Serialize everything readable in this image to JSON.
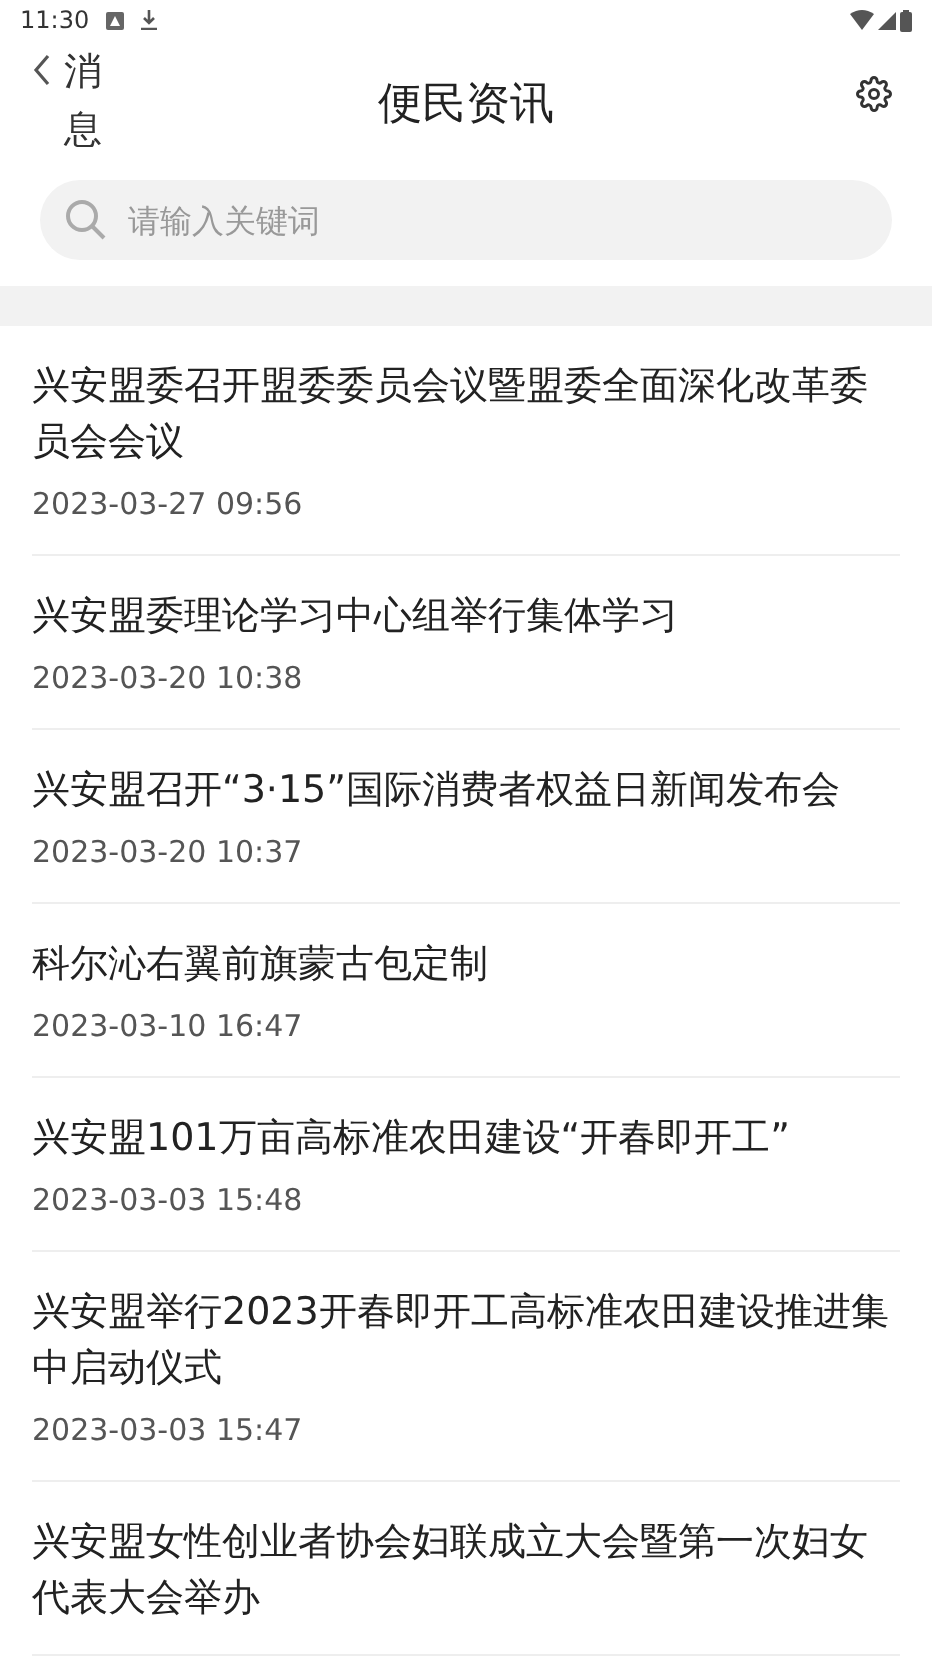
{
  "status_bar": {
    "time": "11:30"
  },
  "header": {
    "back_label": "消息",
    "title": "便民资讯"
  },
  "search": {
    "placeholder": "请输入关键词"
  },
  "news": [
    {
      "title": "兴安盟委召开盟委委员会议暨盟委全面深化改革委员会会议",
      "date": "2023-03-27  09:56"
    },
    {
      "title": "兴安盟委理论学习中心组举行集体学习",
      "date": "2023-03-20  10:38"
    },
    {
      "title": "兴安盟召开“3·15”国际消费者权益日新闻发布会",
      "date": "2023-03-20  10:37"
    },
    {
      "title": "科尔沁右翼前旗蒙古包定制",
      "date": "2023-03-10  16:47"
    },
    {
      "title": "兴安盟101万亩高标准农田建设“开春即开工”",
      "date": "2023-03-03  15:48"
    },
    {
      "title": "兴安盟举行2023开春即开工高标准农田建设推进集中启动仪式",
      "date": "2023-03-03  15:47"
    },
    {
      "title": "兴安盟女性创业者协会妇联成立大会暨第一次妇女代表大会举办"
    }
  ]
}
